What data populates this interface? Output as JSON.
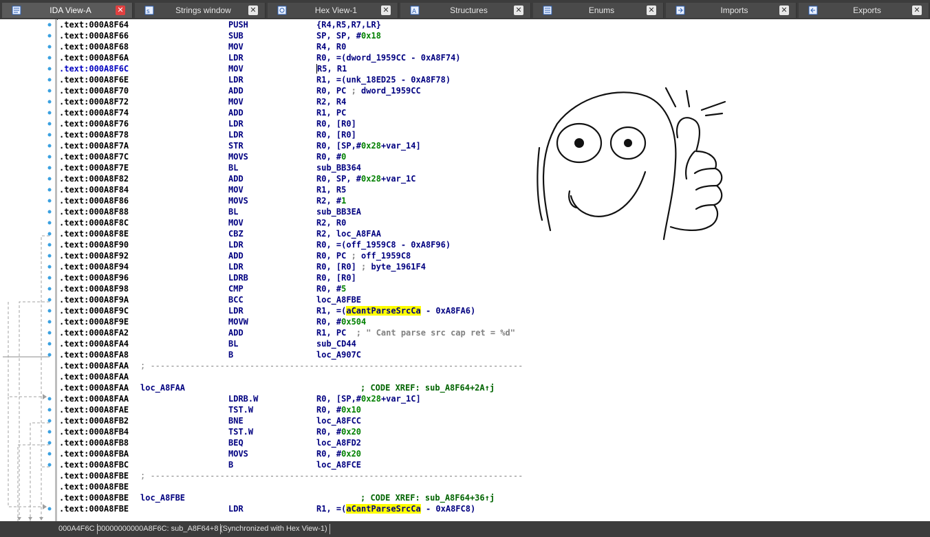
{
  "tabs": [
    {
      "label": "IDA View-A",
      "icon": "ida-view-icon",
      "active": true
    },
    {
      "label": "Strings window",
      "icon": "strings-icon",
      "active": false
    },
    {
      "label": "Hex View-1",
      "icon": "hex-view-icon",
      "active": false
    },
    {
      "label": "Structures",
      "icon": "structures-icon",
      "active": false
    },
    {
      "label": "Enums",
      "icon": "enums-icon",
      "active": false
    },
    {
      "label": "Imports",
      "icon": "imports-icon",
      "active": false
    },
    {
      "label": "Exports",
      "icon": "exports-icon",
      "active": false
    }
  ],
  "tab_close_glyph": "✕",
  "listing": {
    "rows": [
      {
        "addr": ".text:000A8F64",
        "mn": "PUSH",
        "ops": "{R4,R5,R7,LR}"
      },
      {
        "addr": ".text:000A8F66",
        "mn": "SUB",
        "ops": "SP, SP, #0x18"
      },
      {
        "addr": ".text:000A8F68",
        "mn": "MOV",
        "ops": "R4, R0"
      },
      {
        "addr": ".text:000A8F6A",
        "mn": "LDR",
        "ops": "R0, =(dword_1959CC - 0xA8F74)"
      },
      {
        "addr": ".text:000A8F6C",
        "mn": "MOV",
        "ops": "R5, R1",
        "current": true
      },
      {
        "addr": ".text:000A8F6E",
        "mn": "LDR",
        "ops": "R1, =(unk_18ED25 - 0xA8F78)"
      },
      {
        "addr": ".text:000A8F70",
        "mn": "ADD",
        "ops": "R0, PC ; dword_1959CC"
      },
      {
        "addr": ".text:000A8F72",
        "mn": "MOV",
        "ops": "R2, R4"
      },
      {
        "addr": ".text:000A8F74",
        "mn": "ADD",
        "ops": "R1, PC"
      },
      {
        "addr": ".text:000A8F76",
        "mn": "LDR",
        "ops": "R0, [R0]"
      },
      {
        "addr": ".text:000A8F78",
        "mn": "LDR",
        "ops": "R0, [R0]"
      },
      {
        "addr": ".text:000A8F7A",
        "mn": "STR",
        "ops": "R0, [SP,#0x28+var_14]"
      },
      {
        "addr": ".text:000A8F7C",
        "mn": "MOVS",
        "ops": "R0, #0"
      },
      {
        "addr": ".text:000A8F7E",
        "mn": "BL",
        "ops": "sub_BB364"
      },
      {
        "addr": ".text:000A8F82",
        "mn": "ADD",
        "ops": "R0, SP, #0x28+var_1C"
      },
      {
        "addr": ".text:000A8F84",
        "mn": "MOV",
        "ops": "R1, R5"
      },
      {
        "addr": ".text:000A8F86",
        "mn": "MOVS",
        "ops": "R2, #1"
      },
      {
        "addr": ".text:000A8F88",
        "mn": "BL",
        "ops": "sub_BB3EA"
      },
      {
        "addr": ".text:000A8F8C",
        "mn": "MOV",
        "ops": "R2, R0"
      },
      {
        "addr": ".text:000A8F8E",
        "mn": "CBZ",
        "ops": "R2, loc_A8FAA"
      },
      {
        "addr": ".text:000A8F90",
        "mn": "LDR",
        "ops": "R0, =(off_1959C8 - 0xA8F96)"
      },
      {
        "addr": ".text:000A8F92",
        "mn": "ADD",
        "ops": "R0, PC ; off_1959C8"
      },
      {
        "addr": ".text:000A8F94",
        "mn": "LDR",
        "ops": "R0, [R0] ; byte_1961F4"
      },
      {
        "addr": ".text:000A8F96",
        "mn": "LDRB",
        "ops": "R0, [R0]"
      },
      {
        "addr": ".text:000A8F98",
        "mn": "CMP",
        "ops": "R0, #5"
      },
      {
        "addr": ".text:000A8F9A",
        "mn": "BCC",
        "ops": "loc_A8FBE"
      },
      {
        "addr": ".text:000A8F9C",
        "mn": "LDR",
        "ops": "R1, =(aCantParseSrcCa - 0xA8FA6)"
      },
      {
        "addr": ".text:000A8F9E",
        "mn": "MOVW",
        "ops": "R0, #0x504"
      },
      {
        "addr": ".text:000A8FA2",
        "mn": "ADD",
        "ops": "R1, PC  ; \" Cant parse src cap ret = %d\""
      },
      {
        "addr": ".text:000A8FA4",
        "mn": "BL",
        "ops": "sub_CD44"
      },
      {
        "addr": ".text:000A8FA8",
        "mn": "B",
        "ops": "loc_A907C"
      },
      {
        "addr": ".text:000A8FAA",
        "sep": "; ---------------------------------------------------------------------------"
      },
      {
        "addr": ".text:000A8FAA"
      },
      {
        "addr": ".text:000A8FAA",
        "label": "loc_A8FAA",
        "xref": "; CODE XREF: sub_A8F64+2A↑j"
      },
      {
        "addr": ".text:000A8FAA",
        "mn": "LDRB.W",
        "ops": "R0, [SP,#0x28+var_1C]"
      },
      {
        "addr": ".text:000A8FAE",
        "mn": "TST.W",
        "ops": "R0, #0x10"
      },
      {
        "addr": ".text:000A8FB2",
        "mn": "BNE",
        "ops": "loc_A8FCC"
      },
      {
        "addr": ".text:000A8FB4",
        "mn": "TST.W",
        "ops": "R0, #0x20"
      },
      {
        "addr": ".text:000A8FB8",
        "mn": "BEQ",
        "ops": "loc_A8FD2"
      },
      {
        "addr": ".text:000A8FBA",
        "mn": "MOVS",
        "ops": "R0, #0x20"
      },
      {
        "addr": ".text:000A8FBC",
        "mn": "B",
        "ops": "loc_A8FCE"
      },
      {
        "addr": ".text:000A8FBE",
        "sep": "; ---------------------------------------------------------------------------"
      },
      {
        "addr": ".text:000A8FBE"
      },
      {
        "addr": ".text:000A8FBE",
        "label": "loc_A8FBE",
        "xref": "; CODE XREF: sub_A8F64+36↑j"
      },
      {
        "addr": ".text:000A8FBE",
        "mn": "LDR",
        "ops": "R1, =(aCantParseSrcCa - 0xA8FC8)"
      }
    ]
  },
  "statusbar": {
    "offset": "000A4F6C",
    "location": "00000000000A8F6C: sub_A8F64+8",
    "sync": "(Synchronized with Hex View-1)"
  }
}
